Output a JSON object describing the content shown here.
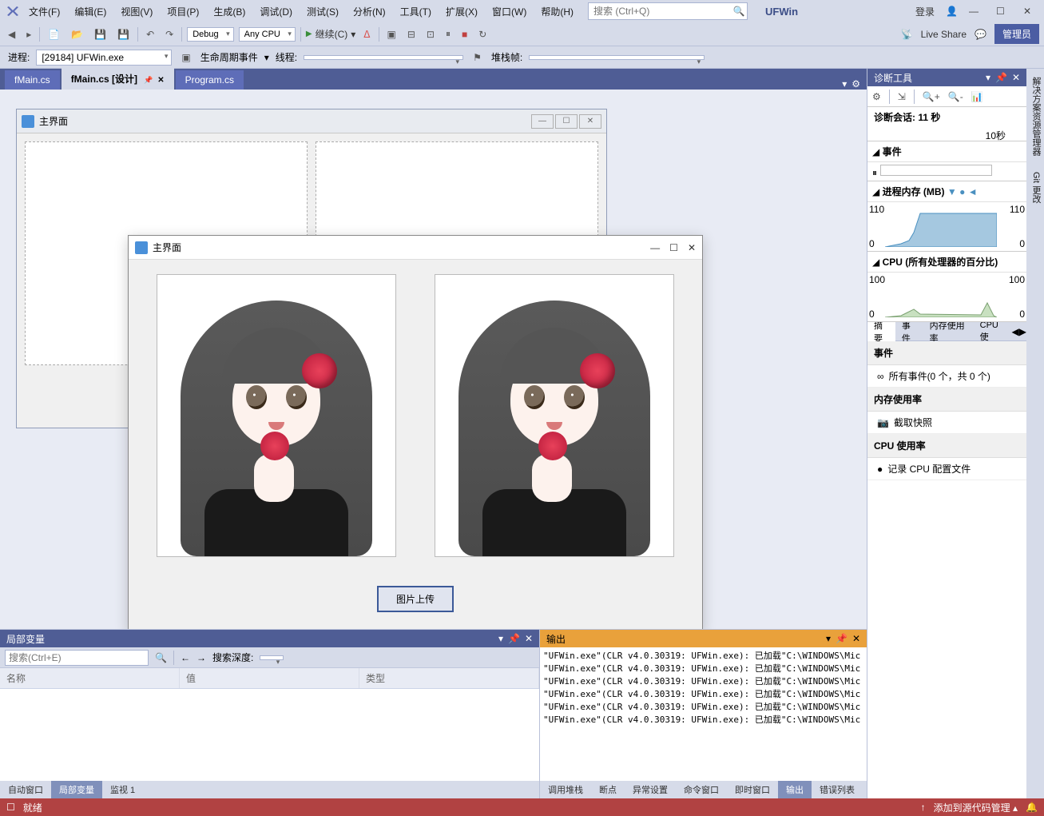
{
  "menu": {
    "file": "文件(F)",
    "edit": "编辑(E)",
    "view": "视图(V)",
    "project": "项目(P)",
    "build": "生成(B)",
    "debug": "调试(D)",
    "test": "测试(S)",
    "analyze": "分析(N)",
    "tools": "工具(T)",
    "extensions": "扩展(X)",
    "window": "窗口(W)",
    "help": "帮助(H)"
  },
  "search_placeholder": "搜索 (Ctrl+Q)",
  "app_name": "UFWin",
  "login": "登录",
  "toolbar": {
    "config": "Debug",
    "platform": "Any CPU",
    "continue": "继续(C)",
    "live_share": "Live Share",
    "admin": "管理员"
  },
  "debugbar": {
    "process_label": "进程:",
    "process": "[29184] UFWin.exe",
    "lifecycle": "生命周期事件",
    "thread_label": "线程:",
    "stack_label": "堆栈帧:"
  },
  "doc_tabs": {
    "t1": "fMain.cs",
    "t2": "fMain.cs [设计]",
    "t3": "Program.cs"
  },
  "designer_window": {
    "title": "主界面"
  },
  "runtime_window": {
    "title": "主界面",
    "upload": "图片上传"
  },
  "diag": {
    "title": "诊断工具",
    "session": "诊断会话: 11 秒",
    "ruler": "10秒",
    "events": "事件",
    "memory": "进程内存 (MB)",
    "cpu": "CPU (所有处理器的百分比)",
    "tabs": {
      "summary": "摘要",
      "events": "事件",
      "memory": "内存使用率",
      "cpu": "CPU 使"
    },
    "events_section": "事件",
    "events_item": "所有事件(0 个，共 0 个)",
    "mem_section": "内存使用率",
    "mem_item": "截取快照",
    "cpu_section": "CPU 使用率",
    "cpu_item": "记录 CPU 配置文件"
  },
  "locals": {
    "title": "局部变量",
    "search": "搜索(Ctrl+E)",
    "depth_label": "搜索深度:",
    "cols": {
      "name": "名称",
      "value": "值",
      "type": "类型"
    },
    "tabs": {
      "auto": "自动窗口",
      "locals": "局部变量",
      "watch": "监视 1"
    }
  },
  "output": {
    "title": "输出",
    "lines": [
      "\"UFWin.exe\"(CLR v4.0.30319: UFWin.exe): 已加载\"C:\\WINDOWS\\Mic",
      "\"UFWin.exe\"(CLR v4.0.30319: UFWin.exe): 已加载\"C:\\WINDOWS\\Mic",
      "\"UFWin.exe\"(CLR v4.0.30319: UFWin.exe): 已加载\"C:\\WINDOWS\\Mic",
      "\"UFWin.exe\"(CLR v4.0.30319: UFWin.exe): 已加载\"C:\\WINDOWS\\Mic",
      "\"UFWin.exe\"(CLR v4.0.30319: UFWin.exe): 已加载\"C:\\WINDOWS\\Mic",
      "\"UFWin.exe\"(CLR v4.0.30319: UFWin.exe): 已加载\"C:\\WINDOWS\\Mic"
    ],
    "tabs": {
      "callstack": "调用堆栈",
      "breakpoints": "断点",
      "exception": "异常设置",
      "cmd": "命令窗口",
      "immediate": "即时窗口",
      "output": "输出",
      "errors": "错误列表"
    }
  },
  "right_tabs": {
    "solution": "解决方案资源管理器",
    "git": "Git 更改"
  },
  "status": {
    "ready": "就绪",
    "source": "添加到源代码管理"
  },
  "chart_data": [
    {
      "type": "area",
      "title": "进程内存 (MB)",
      "x": [
        0,
        2,
        3,
        4,
        11
      ],
      "values": [
        0,
        20,
        40,
        105,
        105
      ],
      "ylim": [
        0,
        110
      ],
      "xlabel": "",
      "ylabel": ""
    },
    {
      "type": "area",
      "title": "CPU (所有处理器的百分比)",
      "x": [
        0,
        2,
        3,
        4,
        9.5,
        10,
        11
      ],
      "values": [
        2,
        8,
        14,
        5,
        4,
        28,
        0
      ],
      "ylim": [
        0,
        100
      ],
      "xlabel": "",
      "ylabel": ""
    }
  ]
}
